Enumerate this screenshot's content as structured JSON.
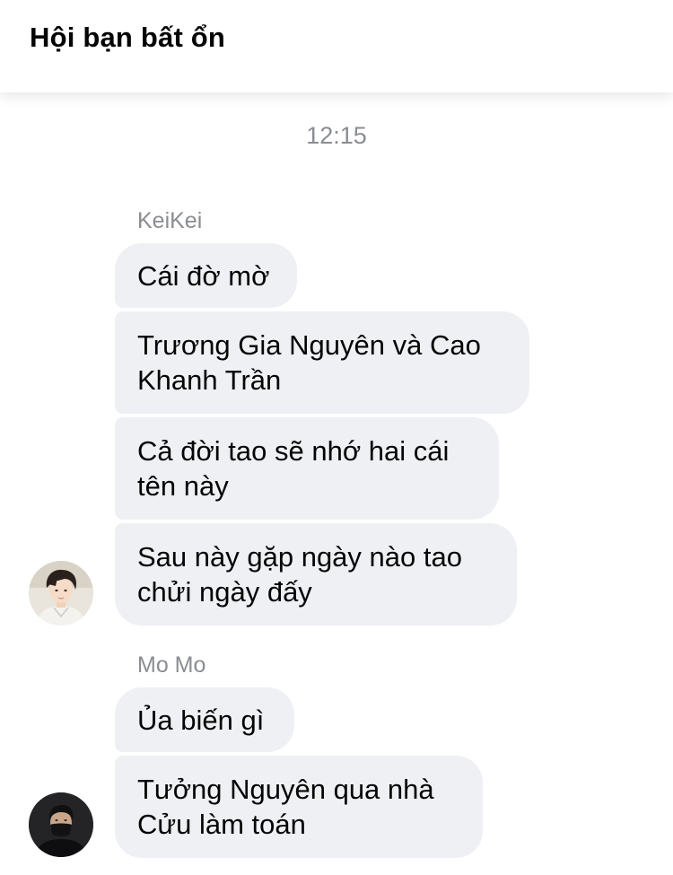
{
  "header": {
    "title": "Hội bạn bất ổn"
  },
  "timestamp": "12:15",
  "groups": [
    {
      "sender": "KeiKei",
      "avatar_icon": "user-avatar-keikei",
      "messages": [
        "Cái đờ mờ",
        "Trương Gia Nguyên và Cao Khanh Trần",
        "Cả đời tao sẽ nhớ hai cái tên này",
        "Sau này gặp ngày nào tao chửi ngày đấy"
      ]
    },
    {
      "sender": "Mo Mo",
      "avatar_icon": "user-avatar-momo",
      "messages": [
        "Ủa biến gì",
        "Tưởng Nguyên qua nhà Cửu làm toán"
      ]
    }
  ],
  "colors": {
    "bubble": "#eff0f4",
    "secondary_text": "#8a8d91",
    "primary_text": "#050505"
  }
}
